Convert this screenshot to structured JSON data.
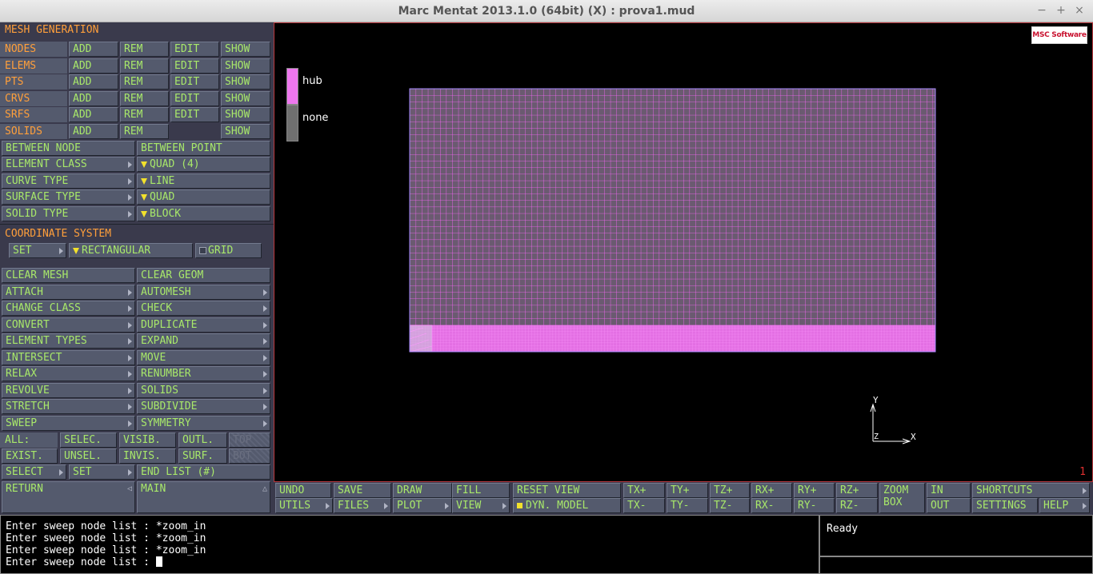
{
  "window": {
    "title": "Marc Mentat 2013.1.0 (64bit) (X) : prova1.mud",
    "controls": [
      "−",
      "+",
      "×"
    ]
  },
  "panel": {
    "header": "MESH GENERATION",
    "entity_rows": [
      {
        "name": "NODES",
        "buttons": [
          "ADD",
          "REM",
          "EDIT",
          "SHOW"
        ]
      },
      {
        "name": "ELEMS",
        "buttons": [
          "ADD",
          "REM",
          "EDIT",
          "SHOW"
        ]
      },
      {
        "name": "PTS",
        "buttons": [
          "ADD",
          "REM",
          "EDIT",
          "SHOW"
        ]
      },
      {
        "name": "CRVS",
        "buttons": [
          "ADD",
          "REM",
          "EDIT",
          "SHOW"
        ]
      },
      {
        "name": "SRFS",
        "buttons": [
          "ADD",
          "REM",
          "EDIT",
          "SHOW"
        ]
      },
      {
        "name": "SOLIDS",
        "buttons": [
          "ADD",
          "REM",
          "",
          "SHOW"
        ]
      }
    ],
    "between_node": "BETWEEN NODE",
    "between_point": "BETWEEN POINT",
    "type_rows": [
      {
        "label": "ELEMENT CLASS",
        "value": "QUAD (4)"
      },
      {
        "label": "CURVE TYPE",
        "value": "LINE"
      },
      {
        "label": "SURFACE TYPE",
        "value": "QUAD"
      },
      {
        "label": "SOLID TYPE",
        "value": "BLOCK"
      }
    ],
    "coord_header": "COORDINATE SYSTEM",
    "coord_set": "SET",
    "coord_type": "RECTANGULAR",
    "coord_grid": "GRID",
    "ops": [
      [
        "CLEAR MESH",
        "CLEAR GEOM"
      ],
      [
        "ATTACH",
        "AUTOMESH"
      ],
      [
        "CHANGE CLASS",
        "CHECK"
      ],
      [
        "CONVERT",
        "DUPLICATE"
      ],
      [
        "ELEMENT TYPES",
        "EXPAND"
      ],
      [
        "INTERSECT",
        "MOVE"
      ],
      [
        "RELAX",
        "RENUMBER"
      ],
      [
        "REVOLVE",
        "SOLIDS"
      ],
      [
        "STRETCH",
        "SUBDIVIDE"
      ],
      [
        "SWEEP",
        "SYMMETRY"
      ]
    ],
    "all_label": "ALL:",
    "all_row1": [
      "SELEC.",
      "VISIB.",
      "OUTL.",
      "TOP"
    ],
    "all_row2": [
      "EXIST.",
      "UNSEL.",
      "INVIS.",
      "SURF.",
      "BOT"
    ],
    "select_label": "SELECT",
    "set_label": "SET",
    "end_list": "END LIST (#)",
    "return_label": "RETURN",
    "main_label": "MAIN"
  },
  "viewport": {
    "legend": [
      {
        "label": "hub",
        "color": "#ee77ee"
      },
      {
        "label": "none",
        "color": "#707070"
      }
    ],
    "logo": "MSC Software",
    "axis_x": "X",
    "axis_y": "Y",
    "axis_z": "Z",
    "viewport_number": "1",
    "mesh_color": "#ff66ff"
  },
  "toolbar": {
    "row1": [
      "UNDO",
      "SAVE",
      "DRAW",
      "FILL",
      "RESET VIEW",
      "TX+",
      "TY+",
      "TZ+",
      "RX+",
      "RY+",
      "RZ+",
      "ZOOM",
      "IN",
      "SHORTCUTS"
    ],
    "row2": [
      "UTILS",
      "FILES",
      "PLOT",
      "VIEW",
      "DYN. MODEL",
      "TX-",
      "TY-",
      "TZ-",
      "RX-",
      "RY-",
      "RZ-",
      "BOX",
      "OUT",
      "SETTINGS",
      "HELP"
    ]
  },
  "console": {
    "lines": [
      "Enter sweep node list : *zoom_in",
      "Enter sweep node list : *zoom_in",
      "Enter sweep node list : *zoom_in",
      "Enter sweep node list : "
    ]
  },
  "status": "Ready"
}
